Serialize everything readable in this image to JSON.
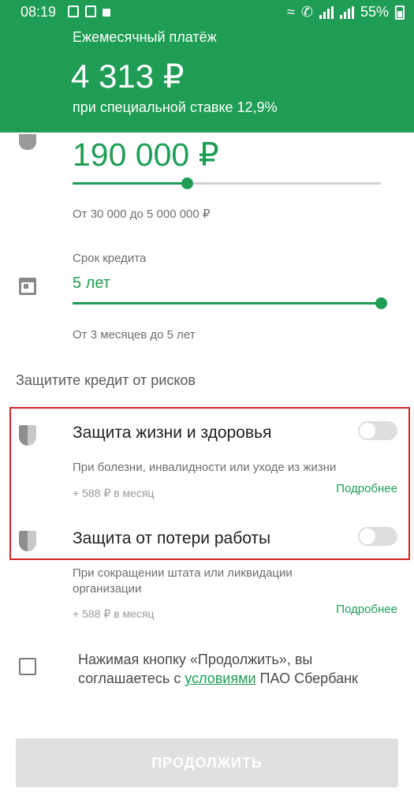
{
  "status_bar": {
    "time": "08:19",
    "battery": "55%"
  },
  "header": {
    "label": "Ежемесячный платёж",
    "amount": "4 313 ₽",
    "rate_text": "при специальной ставке 12,9%"
  },
  "loan": {
    "amount": "190 000 ₽",
    "slider_fraction": 0.37,
    "range_hint": "От 30 000 до 5 000 000 ₽"
  },
  "term": {
    "label": "Срок кредита",
    "value": "5 лет",
    "slider_fraction": 1.0,
    "range_hint": "От 3 месяцев до 5 лет"
  },
  "protection": {
    "title": "Защитите кредит от рисков",
    "items": [
      {
        "title": "Защита жизни и здоровья",
        "description": "При болезни, инвалидности или уходе из жизни",
        "price": "+ 588 ₽ в месяц",
        "more": "Подробнее",
        "enabled": false
      },
      {
        "title": "Защита от потери работы",
        "description": "При сокращении штата или ликвидации организации",
        "price": "+ 588 ₽ в месяц",
        "more": "Подробнее",
        "enabled": false
      }
    ]
  },
  "agreement": {
    "text_before": "Нажимая кнопку «Продолжить», вы соглашаетесь с ",
    "link": "условиями",
    "text_after": " ПАО Сбербанк",
    "checked": false
  },
  "continue_button": "ПРОДОЛЖИТЬ",
  "colors": {
    "accent": "#1f9d55",
    "highlight_border": "#d32027"
  }
}
